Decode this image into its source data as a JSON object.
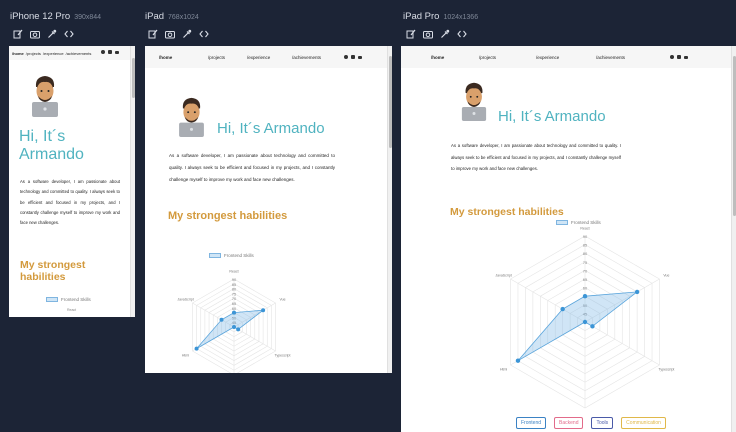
{
  "devices": [
    {
      "name": "iPhone 12 Pro",
      "size": "390x844"
    },
    {
      "name": "iPad",
      "size": "768x1024"
    },
    {
      "name": "iPad Pro",
      "size": "1024x1366"
    }
  ],
  "tool_icons": [
    "edit-icon",
    "camera-icon",
    "eyedropper-icon",
    "code-icon"
  ],
  "site": {
    "nav": [
      "/home",
      "/projects",
      "/experience",
      "/achievements"
    ],
    "nav_icons": [
      "github-icon",
      "linkedin-icon",
      "mail-icon"
    ],
    "hero_title": "Hi, It´s Armando",
    "intro": "As a software developer, I am passionate about technology and committed to quality. I always seek to be efficient and focused in my projects, and I constantly challenge myself to improve my work and face new challenges.",
    "section_title": "My strongest habilities",
    "chart_data": {
      "type": "radar",
      "legend": "Frontend Skills",
      "axes": [
        "React",
        "Vue",
        "Typescript",
        "Angular",
        "Html",
        "JavaScript"
      ],
      "ticks": [
        "90",
        "85",
        "80",
        "75",
        "70",
        "65",
        "60",
        "55",
        "50",
        "45"
      ],
      "range": [
        40,
        90
      ],
      "values": [
        55,
        75,
        45,
        40,
        85,
        55
      ]
    },
    "bottom_tabs": [
      {
        "label": "Frontend",
        "color": "#3b82c4"
      },
      {
        "label": "Backend",
        "color": "#e26b8a"
      },
      {
        "label": "Tools",
        "color": "#4a5aa8"
      },
      {
        "label": "Communication",
        "color": "#e0b84a"
      }
    ]
  }
}
